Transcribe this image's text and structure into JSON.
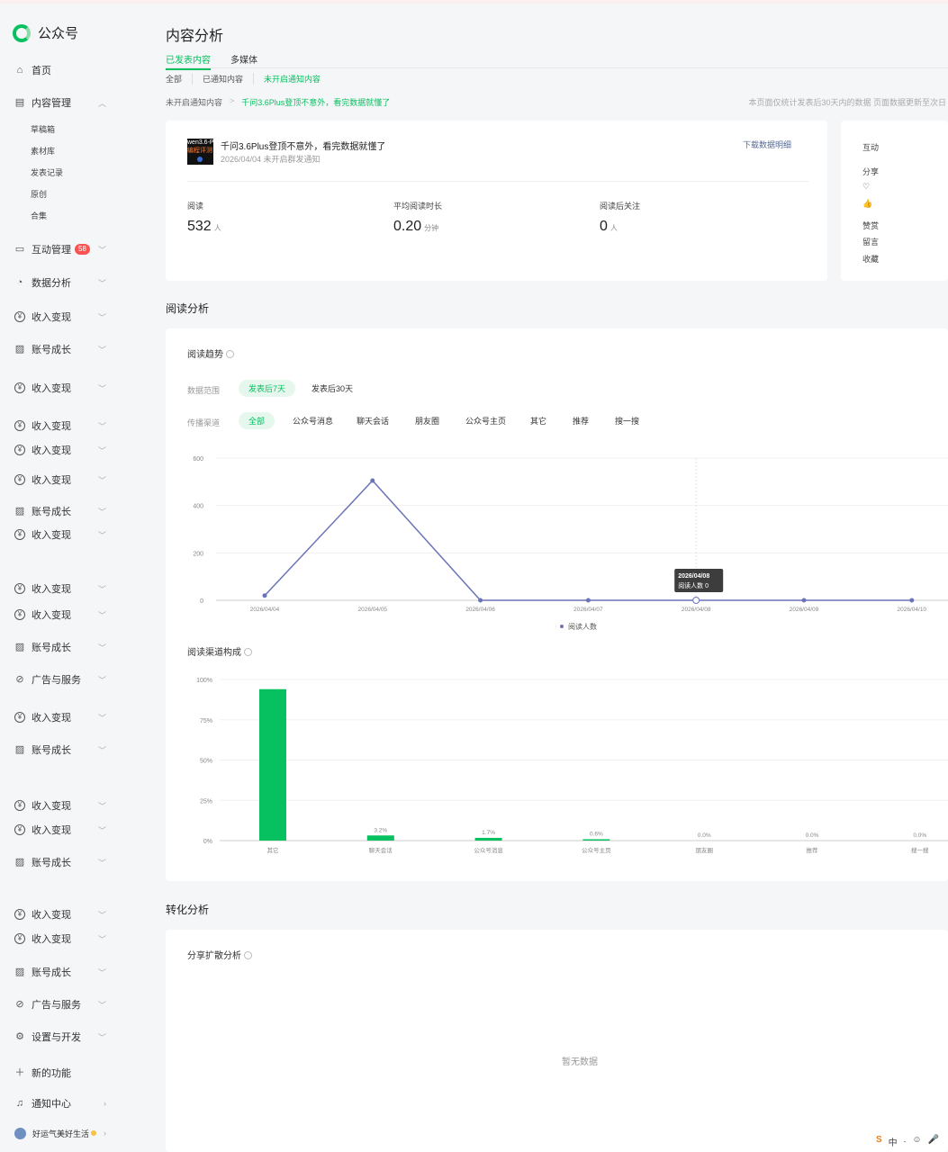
{
  "app": {
    "name": "公众号"
  },
  "sidebar": {
    "home": "首页",
    "content_mgmt": "内容管理",
    "content_sub": [
      "草稿箱",
      "素材库",
      "发表记录",
      "原创",
      "合集"
    ],
    "interaction": "互动管理",
    "interaction_badge": "58",
    "data_analysis": "数据分析",
    "items": [
      {
        "label": "收入变现",
        "icon": "yuan-icon"
      },
      {
        "label": "账号成长",
        "icon": "chart-icon"
      },
      {
        "label": "收入变现",
        "icon": "yuan-icon"
      },
      {
        "label": "收入变现",
        "icon": "yuan-icon"
      },
      {
        "label": "收入变现",
        "icon": "yuan-icon"
      },
      {
        "label": "收入变现",
        "icon": "yuan-icon"
      },
      {
        "label": "账号成长",
        "icon": "chart-icon"
      },
      {
        "label": "收入变现",
        "icon": "yuan-icon"
      },
      {
        "label": "收入变现",
        "icon": "yuan-icon"
      },
      {
        "label": "收入变现",
        "icon": "yuan-icon"
      },
      {
        "label": "账号成长",
        "icon": "chart-icon"
      },
      {
        "label": "广告与服务",
        "icon": "compass-icon"
      },
      {
        "label": "收入变现",
        "icon": "yuan-icon"
      },
      {
        "label": "账号成长",
        "icon": "chart-icon"
      },
      {
        "label": "收入变现",
        "icon": "yuan-icon"
      },
      {
        "label": "收入变现",
        "icon": "yuan-icon"
      },
      {
        "label": "账号成长",
        "icon": "chart-icon"
      },
      {
        "label": "收入变现",
        "icon": "yuan-icon"
      },
      {
        "label": "收入变现",
        "icon": "yuan-icon"
      },
      {
        "label": "账号成长",
        "icon": "chart-icon"
      },
      {
        "label": "广告与服务",
        "icon": "compass-icon"
      },
      {
        "label": "设置与开发",
        "icon": "gear-icon"
      }
    ],
    "new_feature": "新的功能",
    "notify": "通知中心",
    "user": "好运气美好生活"
  },
  "page": {
    "title": "内容分析",
    "tabs": [
      "已发表内容",
      "多媒体"
    ],
    "subtabs": [
      "全部",
      "已通知内容",
      "未开启通知内容"
    ],
    "crumb_parent": "未开启通知内容",
    "crumb_sep": ">",
    "crumb_current": "千问3.6Plus登顶不意外，看完数据就懂了",
    "note": "本页面仅统计发表后30天内的数据 页面数据更新至次日"
  },
  "article": {
    "thumb_line1": "wen3.6-P",
    "thumb_line2": "编程评测",
    "title": "千问3.6Plus登顶不意外，看完数据就懂了",
    "meta": "2026/04/04  未开启群发通知",
    "download": "下载数据明细",
    "stats": [
      {
        "label": "阅读",
        "value": "532",
        "unit": "人"
      },
      {
        "label": "平均阅读时长",
        "value": "0.20",
        "unit": "分钟"
      },
      {
        "label": "阅读后关注",
        "value": "0",
        "unit": "人"
      }
    ]
  },
  "interaction_panel": {
    "title": "互动",
    "items": [
      "分享",
      "♡",
      "👍",
      "赞赏",
      "留言",
      "收藏"
    ]
  },
  "reading": {
    "section_title": "阅读分析",
    "trend_title": "阅读趋势",
    "range_label": "数据范围",
    "ranges": [
      "发表后7天",
      "发表后30天"
    ],
    "channel_label": "传播渠道",
    "channels": [
      "全部",
      "公众号消息",
      "聊天会话",
      "朋友圈",
      "公众号主页",
      "其它",
      "推荐",
      "搜一搜"
    ],
    "tooltip_date": "2026/04/08",
    "tooltip_text": "阅读人数 0",
    "legend": "阅读人数",
    "channel_title": "阅读渠道构成"
  },
  "conversion": {
    "section_title": "转化分析",
    "share_title": "分享扩散分析",
    "empty": "暂无数据"
  },
  "tray": [
    "S",
    "中",
    "⸱",
    "☺",
    "🎤"
  ],
  "chart_data": [
    {
      "type": "line",
      "x": [
        "2026/04/04",
        "2026/04/05",
        "2026/04/06",
        "2026/04/07",
        "2026/04/08",
        "2026/04/09",
        "2026/04/10"
      ],
      "series": [
        {
          "name": "阅读人数",
          "values": [
            20,
            505,
            0,
            0,
            0,
            0,
            0
          ]
        }
      ],
      "yticks": [
        "0",
        "200",
        "400",
        "600"
      ],
      "ylim": [
        0,
        600
      ],
      "color": "#6b74b8"
    },
    {
      "type": "bar",
      "categories": [
        "其它",
        "聊天会话",
        "公众号消息",
        "公众号主页",
        "朋友圈",
        "推荐",
        "搜一搜"
      ],
      "values": [
        94.0,
        3.2,
        1.7,
        0.6,
        0.0,
        0.0,
        0.0
      ],
      "labels": [
        "",
        "3.2%",
        "1.7%",
        "0.6%",
        "0.0%",
        "0.0%",
        "0.0%"
      ],
      "yticks": [
        "0%",
        "25%",
        "50%",
        "75%",
        "100%"
      ],
      "ylim": [
        0,
        100
      ],
      "color": "#07c160"
    }
  ]
}
